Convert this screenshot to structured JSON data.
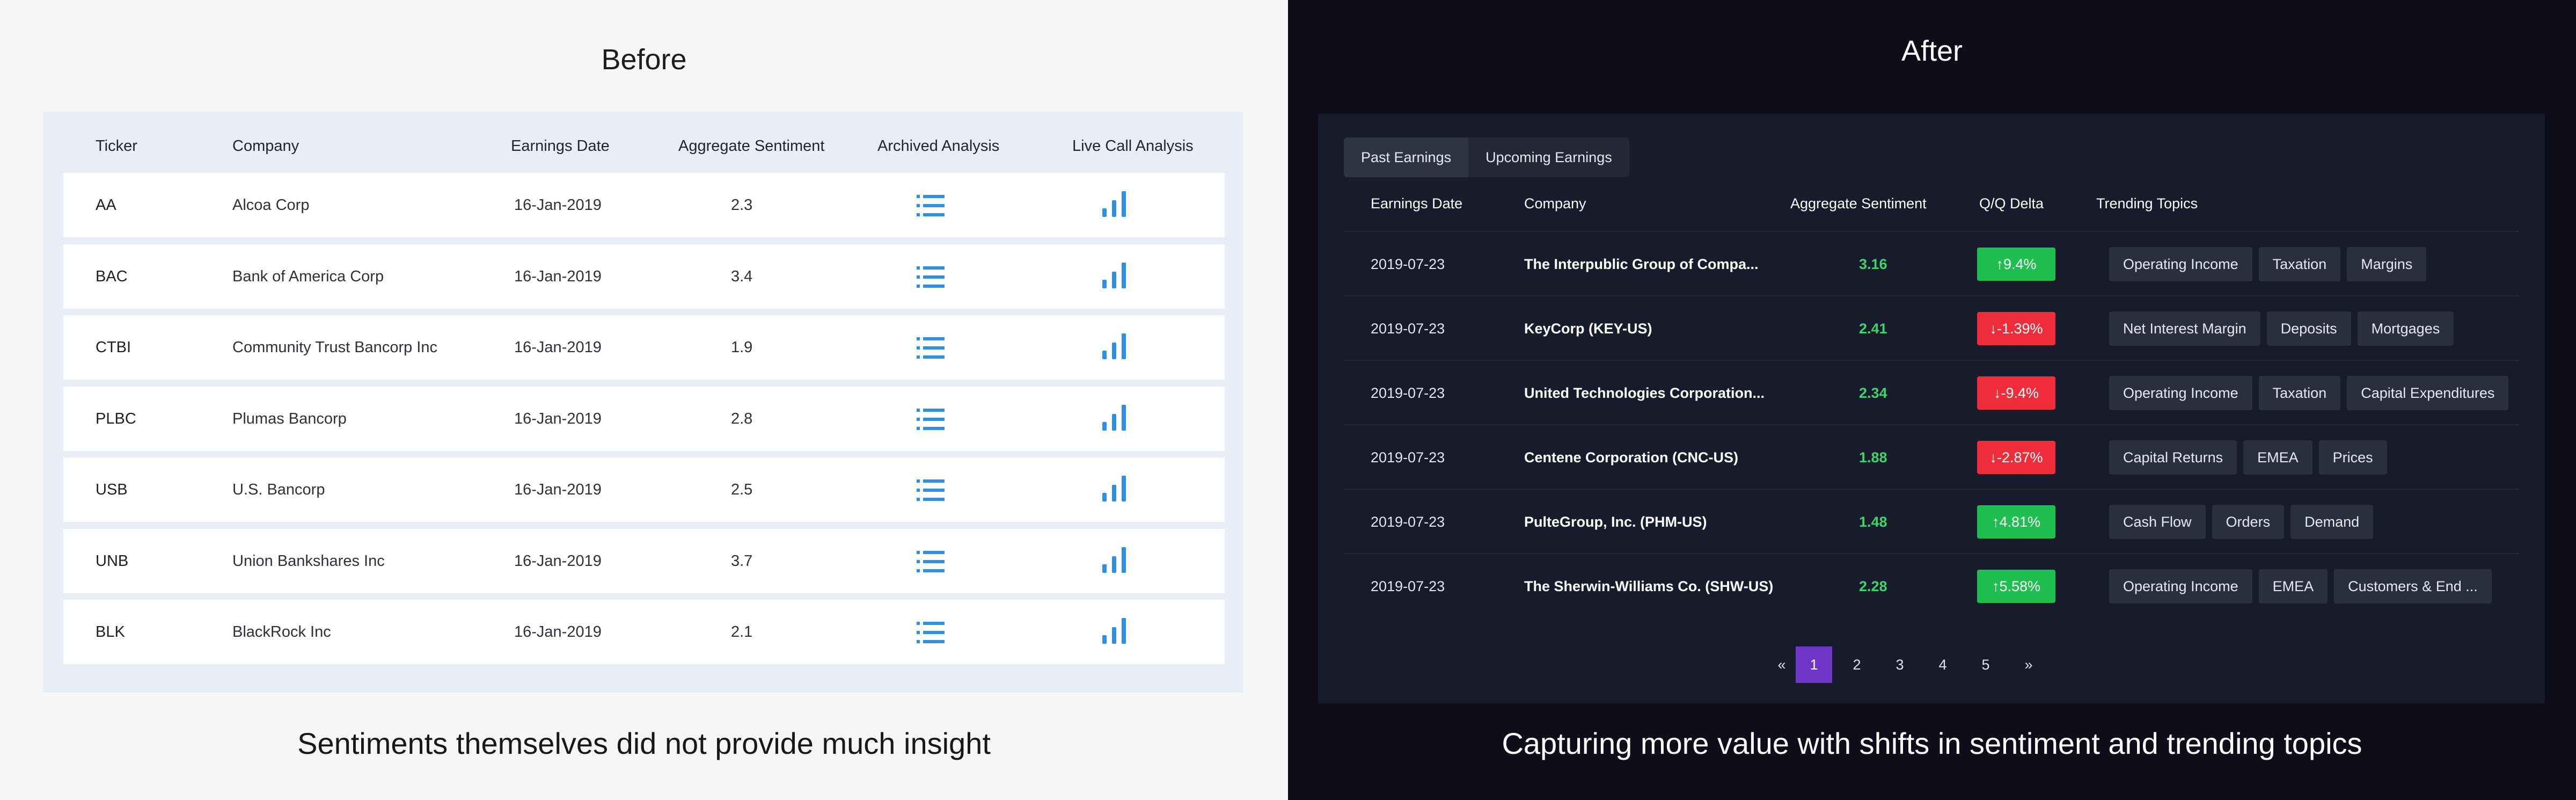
{
  "before": {
    "title": "Before",
    "columns": [
      "Ticker",
      "Company",
      "Earnings Date",
      "Aggregate Sentiment",
      "Archived Analysis",
      "Live Call Analysis"
    ],
    "rows": [
      {
        "ticker": "AA",
        "company": "Alcoa Corp",
        "date": "16-Jan-2019",
        "sentiment": "2.3"
      },
      {
        "ticker": "BAC",
        "company": "Bank of America Corp",
        "date": "16-Jan-2019",
        "sentiment": "3.4"
      },
      {
        "ticker": "CTBI",
        "company": "Community Trust Bancorp Inc",
        "date": "16-Jan-2019",
        "sentiment": "1.9"
      },
      {
        "ticker": "PLBC",
        "company": "Plumas Bancorp",
        "date": "16-Jan-2019",
        "sentiment": "2.8"
      },
      {
        "ticker": "USB",
        "company": "U.S. Bancorp",
        "date": "16-Jan-2019",
        "sentiment": "2.5"
      },
      {
        "ticker": "UNB",
        "company": "Union Bankshares Inc",
        "date": "16-Jan-2019",
        "sentiment": "3.7"
      },
      {
        "ticker": "BLK",
        "company": "BlackRock Inc",
        "date": "16-Jan-2019",
        "sentiment": "2.1"
      }
    ],
    "archived_icon": "list-icon",
    "live_icon": "bar-chart-icon",
    "icon_color": "#2f8fe0",
    "caption": "Sentiments themselves did not provide much insight"
  },
  "after": {
    "title": "After",
    "tabs": [
      "Past Earnings",
      "Upcoming Earnings"
    ],
    "active_tab": 0,
    "columns": [
      "Earnings Date",
      "Company",
      "Aggregate Sentiment",
      "Q/Q Delta",
      "Trending Topics"
    ],
    "rows": [
      {
        "date": "2019-07-23",
        "company": "The Interpublic Group of Compa...",
        "sentiment": "3.16",
        "delta": "↑9.4%",
        "direction": "up",
        "topics": [
          "Operating Income",
          "Taxation",
          "Margins"
        ]
      },
      {
        "date": "2019-07-23",
        "company": "KeyCorp (KEY-US)",
        "sentiment": "2.41",
        "delta": "↓-1.39%",
        "direction": "down",
        "topics": [
          "Net Interest Margin",
          "Deposits",
          "Mortgages"
        ]
      },
      {
        "date": "2019-07-23",
        "company": "United Technologies Corporation...",
        "sentiment": "2.34",
        "delta": "↓-9.4%",
        "direction": "down",
        "topics": [
          "Operating Income",
          "Taxation",
          "Capital Expenditures"
        ]
      },
      {
        "date": "2019-07-23",
        "company": "Centene Corporation (CNC-US)",
        "sentiment": "1.88",
        "delta": "↓-2.87%",
        "direction": "down",
        "topics": [
          "Capital Returns",
          "EMEA",
          "Prices"
        ]
      },
      {
        "date": "2019-07-23",
        "company": "PulteGroup, Inc. (PHM-US)",
        "sentiment": "1.48",
        "delta": "↑4.81%",
        "direction": "up",
        "topics": [
          "Cash Flow",
          "Orders",
          "Demand"
        ]
      },
      {
        "date": "2019-07-23",
        "company": "The Sherwin-Williams Co. (SHW-US)",
        "sentiment": "2.28",
        "delta": "↑5.58%",
        "direction": "up",
        "topics": [
          "Operating Income",
          "EMEA",
          "Customers & End ..."
        ]
      }
    ],
    "pagination": {
      "prev": "«",
      "pages": [
        "1",
        "2",
        "3",
        "4",
        "5"
      ],
      "next": "»",
      "current": "1"
    },
    "colors": {
      "up": "#1fbf4f",
      "down": "#ef2d3a",
      "sentiment": "#3fd36b",
      "active_page": "#6f35c7"
    },
    "caption": "Capturing more value with shifts in sentiment and trending topics"
  }
}
